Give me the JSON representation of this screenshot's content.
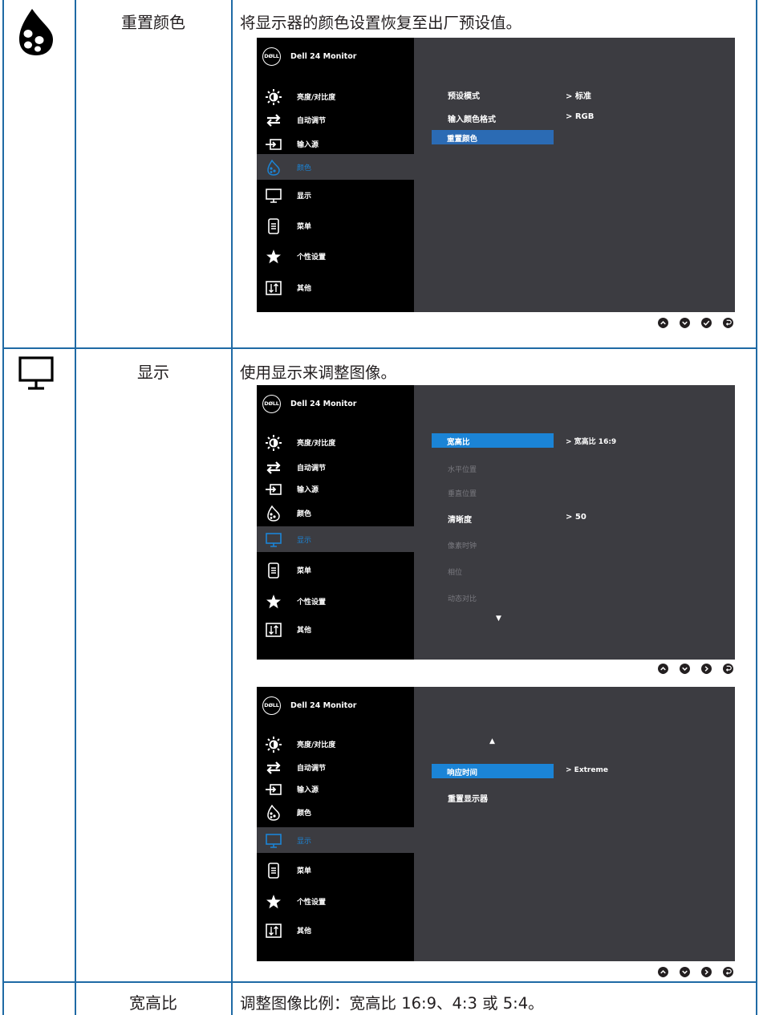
{
  "rows": [
    {
      "name": "重置颜色",
      "description": "将显示器的颜色设置恢复至出厂预设值。"
    },
    {
      "name": "显示",
      "description": "使用显示来调整图像。"
    },
    {
      "name": "宽高比",
      "description": "调整图像比例：宽高比 16:9、4:3 或 5:4。"
    }
  ],
  "osd": {
    "logo": "DØLL",
    "model": "Dell 24 Monitor",
    "menu": [
      "亮度/对比度",
      "自动调节",
      "输入源",
      "颜色",
      "显示",
      "菜单",
      "个性设置",
      "其他"
    ]
  },
  "osd_color": {
    "items": [
      "预设模式",
      "输入颜色格式",
      "重置颜色"
    ],
    "values": [
      "> 标准",
      "> RGB"
    ],
    "highlight_color": "#2b6bb4"
  },
  "osd_display1": {
    "items": [
      "宽高比",
      "水平位置",
      "垂直位置",
      "清晰度",
      "像素时钟",
      "相位",
      "动态对比"
    ],
    "values": [
      "> 宽高比 16:9",
      "> 50"
    ],
    "arrow_down": "▼",
    "highlight_color": "#1b84d6"
  },
  "osd_display2": {
    "items": [
      "响应时间",
      "重置显示器"
    ],
    "values": [
      "> Extreme"
    ],
    "arrow_up": "▲",
    "highlight_color": "#1b84d6"
  },
  "colors": {
    "grid_line": "#1f6aa5",
    "osd_bg": "#3c3c41",
    "osd_menu_bg": "#000000",
    "accent": "#1b84d6"
  },
  "icons": [
    "color-drop-icon",
    "monitor-icon",
    "brightness-icon",
    "auto-adjust-icon",
    "input-source-icon",
    "color-icon",
    "display-icon",
    "menu-icon",
    "personalize-star-icon",
    "others-icon",
    "up-button-icon",
    "down-button-icon",
    "ok-button-icon",
    "next-button-icon",
    "back-button-icon"
  ]
}
